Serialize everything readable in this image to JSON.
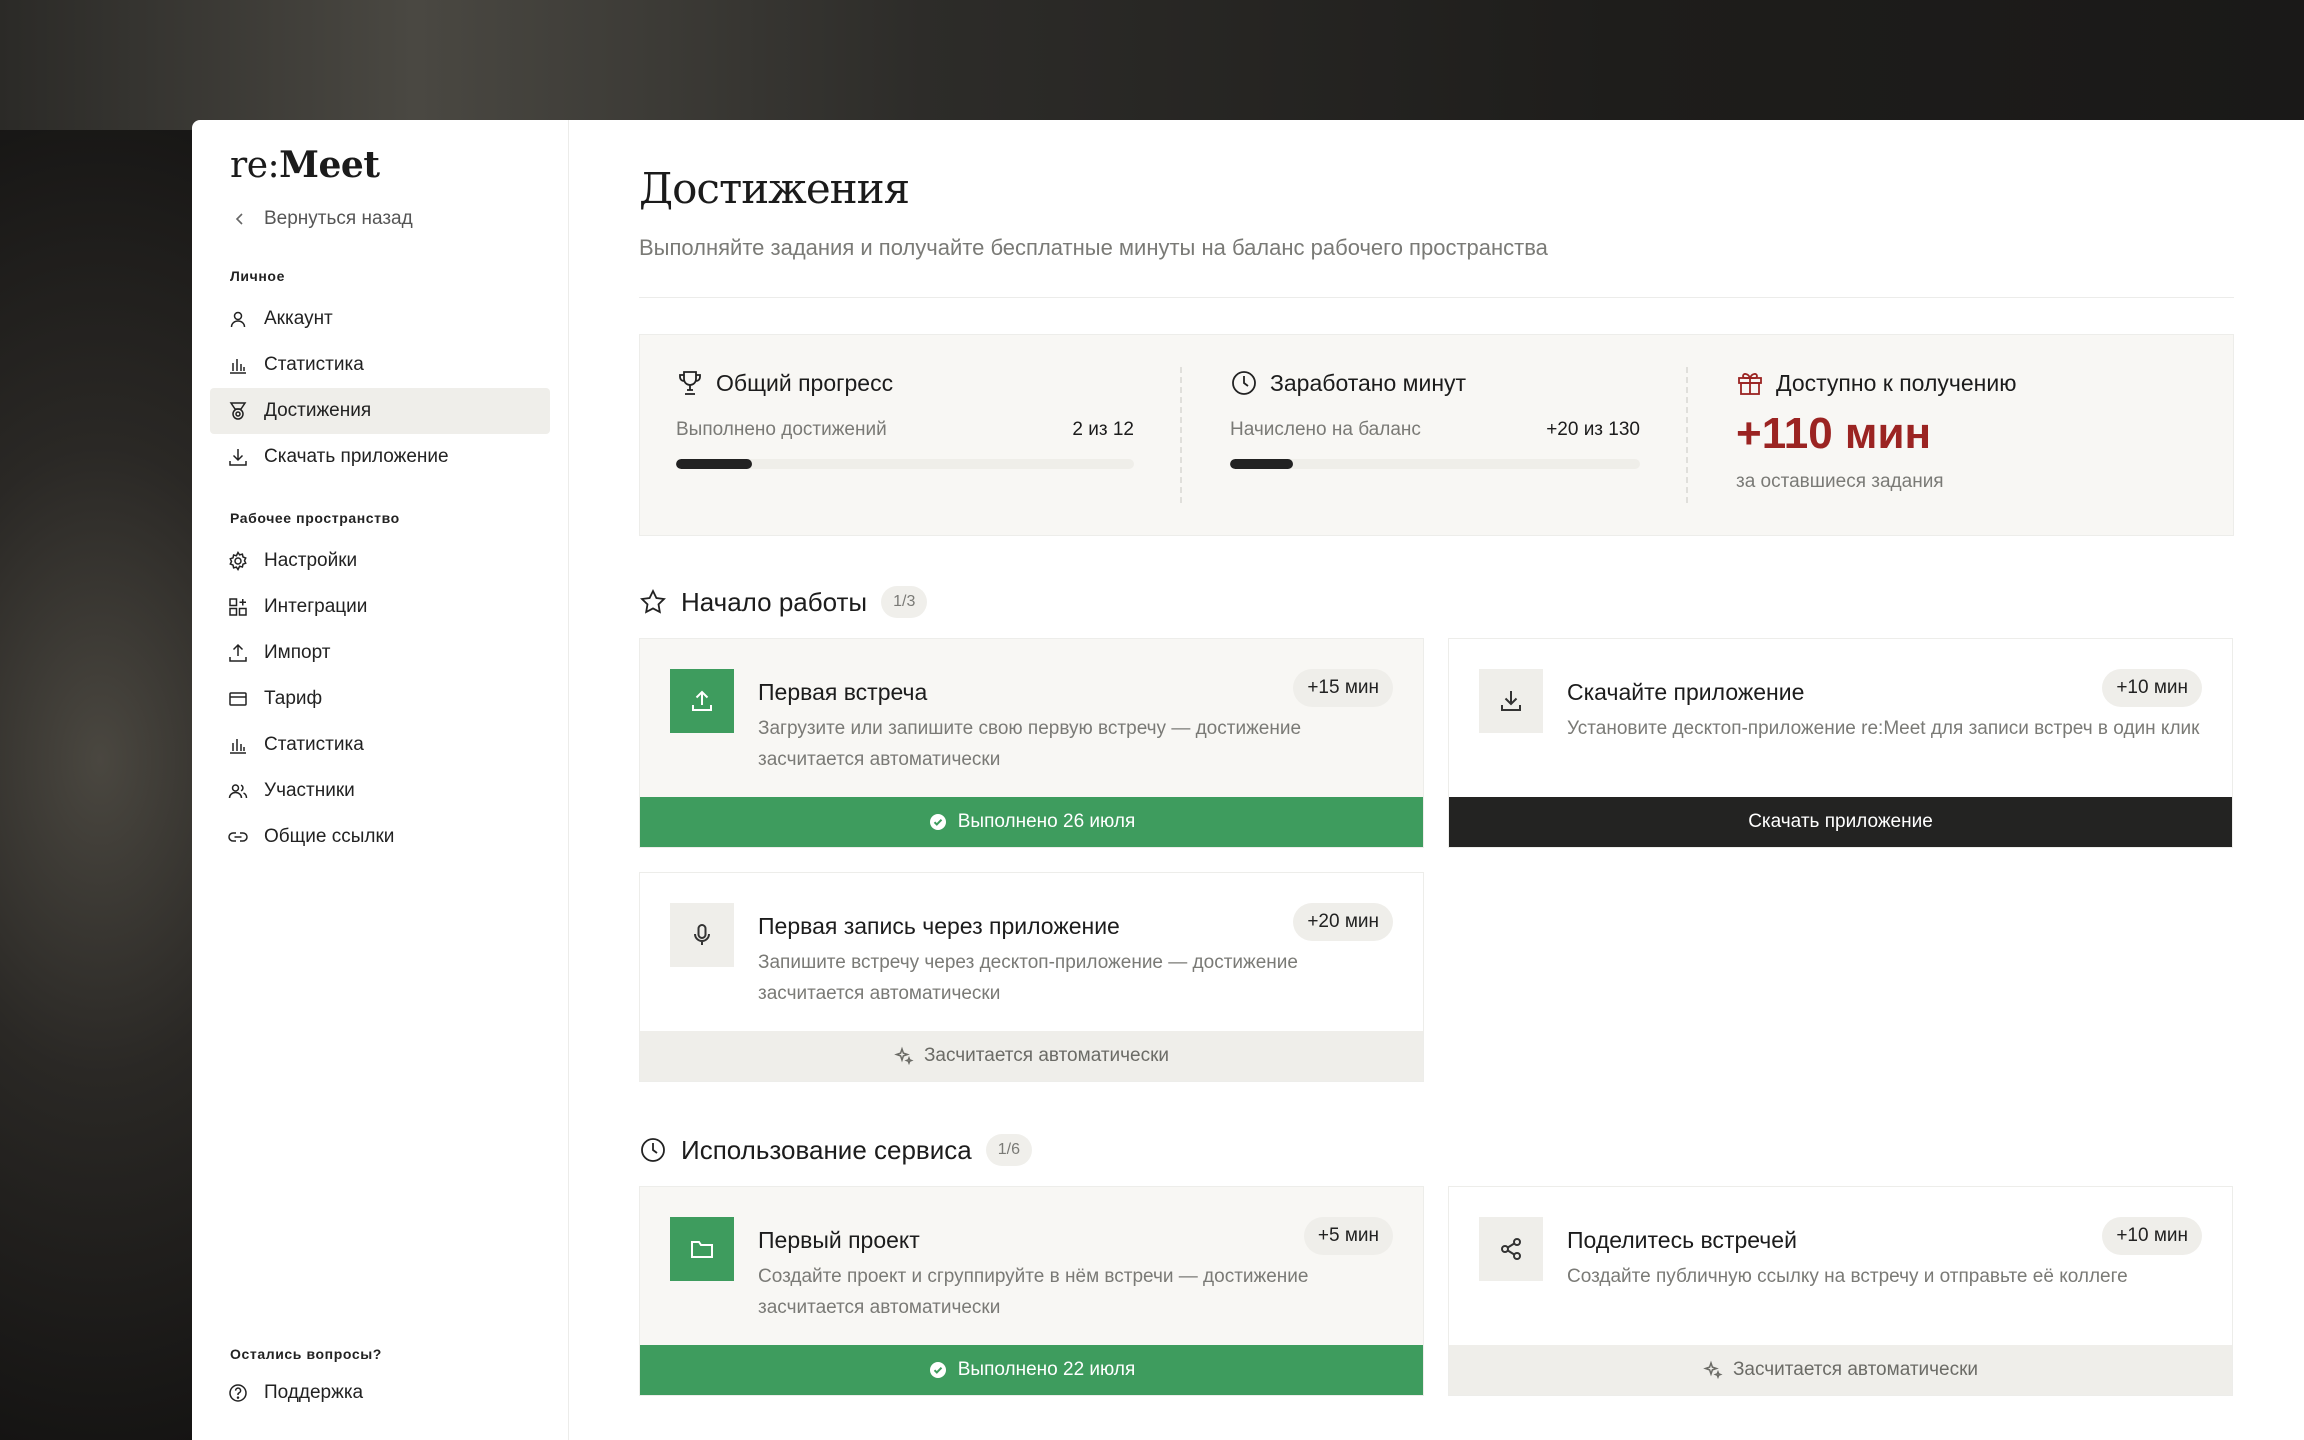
{
  "app": {
    "logo_light": "re:",
    "logo_bold": "Meet"
  },
  "sidebar": {
    "back_label": "Вернуться назад",
    "personal_title": "Личное",
    "personal_items": [
      {
        "label": "Аккаунт",
        "icon": "user-icon"
      },
      {
        "label": "Статистика",
        "icon": "bar-chart-icon"
      },
      {
        "label": "Достижения",
        "icon": "medal-icon",
        "active": true
      },
      {
        "label": "Скачать приложение",
        "icon": "download-icon"
      }
    ],
    "workspace_title": "Рабочее пространство",
    "workspace_items": [
      {
        "label": "Настройки",
        "icon": "gear-icon"
      },
      {
        "label": "Интеграции",
        "icon": "grid-plus-icon"
      },
      {
        "label": "Импорт",
        "icon": "upload-icon"
      },
      {
        "label": "Тариф",
        "icon": "credit-card-icon"
      },
      {
        "label": "Статистика",
        "icon": "bar-chart-icon"
      },
      {
        "label": "Участники",
        "icon": "users-icon"
      },
      {
        "label": "Общие ссылки",
        "icon": "link-icon"
      }
    ],
    "help_title": "Остались вопросы?",
    "support_label": "Поддержка"
  },
  "page": {
    "title": "Достижения",
    "subtitle": "Выполняйте задания и получайте бесплатные минуты на баланс рабочего пространства"
  },
  "summary": {
    "progress": {
      "title": "Общий прогресс",
      "label": "Выполнено достижений",
      "value": "2 из 12",
      "fraction": 0.167
    },
    "earned": {
      "title": "Заработано минут",
      "label": "Начислено на баланс",
      "value": "+20 из 130",
      "fraction": 0.154
    },
    "available": {
      "title": "Доступно к получению",
      "value": "+110 мин",
      "note": "за оставшиеся задания",
      "accent": "#9b2422"
    }
  },
  "groups": [
    {
      "title": "Начало работы",
      "icon": "star-icon",
      "count": "1/3",
      "cards": [
        {
          "title": "Первая встреча",
          "reward": "+15 мин",
          "desc": "Загрузите или запишите свою первую встречу — достижение засчитается автоматически",
          "icon": "upload-icon",
          "status": "done",
          "footer": "Выполнено 26 июля"
        },
        {
          "title": "Скачайте приложение",
          "reward": "+10 мин",
          "desc": "Установите десктоп-приложение re:Meet для записи встреч в один клик",
          "icon": "download-icon",
          "status": "action",
          "footer": "Скачать приложение"
        },
        {
          "title": "Первая запись через приложение",
          "reward": "+20 мин",
          "desc": "Запишите встречу через десктоп-приложение — достижение засчитается автоматически",
          "icon": "microphone-icon",
          "status": "auto",
          "footer": "Засчитается автоматически"
        }
      ]
    },
    {
      "title": "Использование сервиса",
      "icon": "clock-icon",
      "count": "1/6",
      "cards": [
        {
          "title": "Первый проект",
          "reward": "+5 мин",
          "desc": "Создайте проект и сгруппируйте в нём встречи — достижение засчитается автоматически",
          "icon": "folder-icon",
          "status": "done",
          "footer": "Выполнено 22 июля"
        },
        {
          "title": "Поделитесь встречей",
          "reward": "+10 мин",
          "desc": "Создайте публичную ссылку на встречу и отправьте её коллеге",
          "icon": "share-icon",
          "status": "auto",
          "footer": "Засчитается автоматически"
        }
      ]
    }
  ],
  "colors": {
    "green": "#3e9c5e",
    "dark": "#232322",
    "accent_red": "#9b2422"
  }
}
